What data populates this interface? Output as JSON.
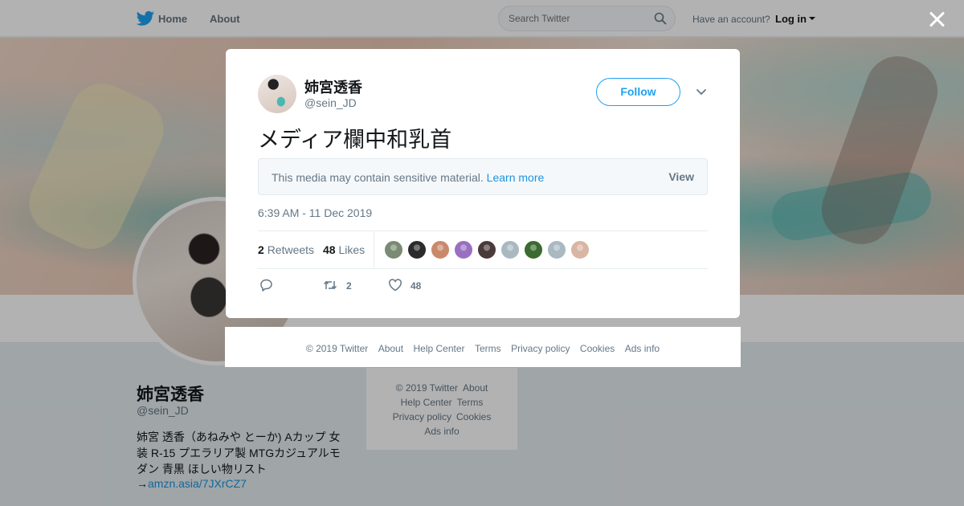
{
  "header": {
    "nav": {
      "home": "Home",
      "about": "About"
    },
    "search": {
      "placeholder": "Search Twitter"
    },
    "account": {
      "prompt": "Have an account?",
      "login": "Log in"
    }
  },
  "profile": {
    "name": "姉宮透香",
    "handle": "@sein_JD",
    "bio": "姉宮 透香（あねみや とーか) Aカップ 女装 R-15 プエラリア製 MTGカジュアルモダン 青黒 ほしい物リスト",
    "bio_arrow": "→",
    "bio_link": "amzn.asia/7JXrCZ7"
  },
  "side_footer": {
    "links": [
      "© 2019 Twitter",
      "About",
      "Help Center",
      "Terms",
      "Privacy policy",
      "Cookies",
      "Ads info"
    ]
  },
  "tweet": {
    "name": "姉宮透香",
    "handle": "@sein_JD",
    "follow_label": "Follow",
    "text": "メディア欄中和乳首",
    "sensitive": {
      "message": "This media may contain sensitive material.",
      "learn_more": "Learn more",
      "view": "View"
    },
    "timestamp": "6:39 AM - 11 Dec 2019",
    "stats": {
      "retweets_count": "2",
      "retweets_label": "Retweets",
      "likes_count": "48",
      "likes_label": "Likes"
    },
    "liker_colors": [
      "#7a8a74",
      "#2b2b2b",
      "#c98a6b",
      "#9a6fc2",
      "#4a3a3a",
      "#aab8c2",
      "#3b6b2e",
      "#aab8c2",
      "#d9b6a4"
    ],
    "actions": {
      "retweet_count": "2",
      "like_count": "48"
    }
  },
  "modal_footer": {
    "links": [
      "© 2019 Twitter",
      "About",
      "Help Center",
      "Terms",
      "Privacy policy",
      "Cookies",
      "Ads info"
    ]
  },
  "colors": {
    "accent": "#1da1f2",
    "link": "#1b95e0",
    "muted": "#657786"
  }
}
